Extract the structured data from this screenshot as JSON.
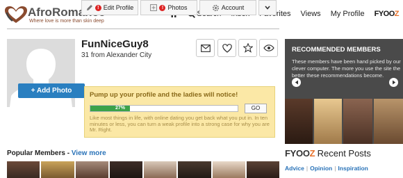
{
  "header": {
    "logo_text": "AfroRomance",
    "logo_reg": "®",
    "tagline": "Where love is more than skin deep",
    "nav": {
      "search": "Search",
      "inbox": "Inbox",
      "favorites": "Favorites",
      "views": "Views",
      "my_profile": "My Profile",
      "fyooz_a": "FYOO",
      "fyooz_b": "Z"
    }
  },
  "profile": {
    "username": "FunNiceGuy8",
    "info": "31 from Alexander City",
    "add_photo": "+ Add Photo",
    "tabs": {
      "edit_profile": "Edit Profile",
      "photos": "Photos",
      "account": "Account",
      "alert_mark": "!"
    }
  },
  "pump": {
    "title": "Pump up your profile and the ladies will notice!",
    "progress_label": "27%",
    "progress_value": 27,
    "go": "GO",
    "description": "Like most things in life, with online dating you get back what you put in. In ten minutes or less, you can turn a weak profile into a strong case for why you are Mr. Right."
  },
  "popular": {
    "title": "Popular Members - ",
    "view_more": "View more"
  },
  "recommended": {
    "title": "RECOMMENDED MEMBERS",
    "description": "These members have been hand picked by our clever computer. The more you use the site the better these recommendations become."
  },
  "recent_posts": {
    "fyooz_a": "FYOO",
    "fyooz_b": "Z",
    "title": "Recent Posts",
    "links": [
      "Advice",
      "Opinion",
      "Inspiration"
    ],
    "separator": "|"
  },
  "colors": {
    "accent": "#2a7fc0",
    "fyooz_orange": "#e8712a",
    "progress_green": "#3ca24a",
    "pump_bg": "#fbe8a6",
    "rec_bg": "#4a4a4a"
  }
}
